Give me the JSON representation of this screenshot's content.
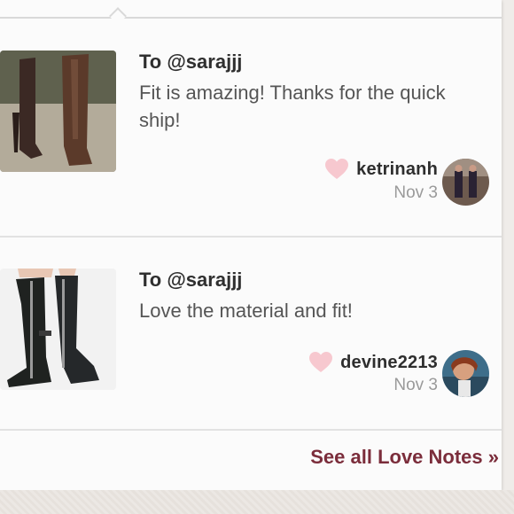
{
  "notes": [
    {
      "to": "To @sarajjj",
      "message": "Fit is amazing! Thanks for the quick ship!",
      "username": "ketrinanh",
      "date": "Nov 3"
    },
    {
      "to": "To @sarajjj",
      "message": "Love the material and fit!",
      "username": "devine2213",
      "date": "Nov 3"
    }
  ],
  "footer": {
    "see_all_label": "See all Love Notes »"
  },
  "colors": {
    "link": "#7b2d3b",
    "heart": "#f7c8cf",
    "card_bg": "#fbfbfb"
  }
}
